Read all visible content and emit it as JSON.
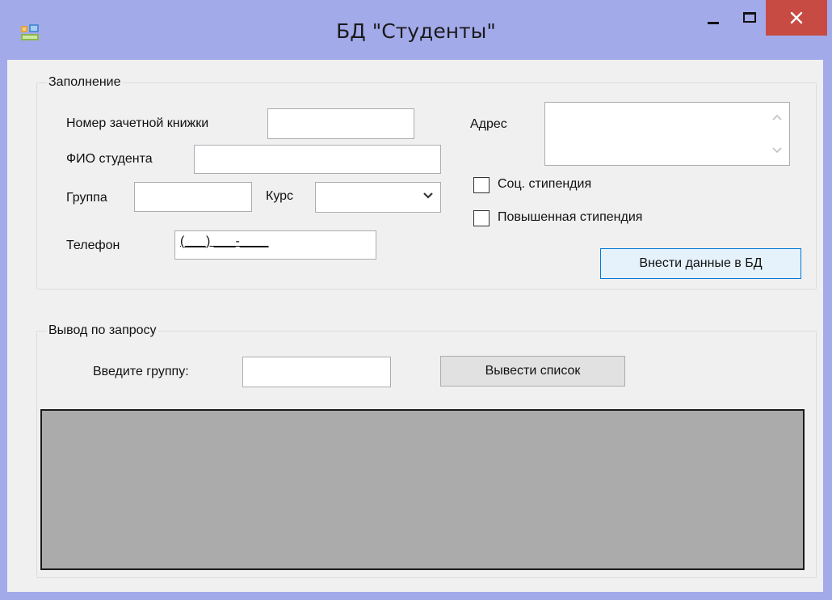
{
  "window": {
    "title": "БД \"Студенты\"",
    "icon": "app-form-icon",
    "colors": {
      "titlebar": "#a3aaea",
      "close_button": "#c74b43",
      "client_bg": "#f0f0f0",
      "grid_bg": "#ababab"
    }
  },
  "fill_group": {
    "legend": "Заполнение",
    "record_book_label": "Номер зачетной книжки",
    "record_book_value": "",
    "student_name_label": "ФИО студента",
    "student_name_value": "",
    "group_label": "Группа",
    "group_value": "",
    "course_label": "Курс",
    "course_value": "",
    "phone_label": "Телефон",
    "phone_mask": "(___) ___-____",
    "address_label": "Адрес",
    "address_value": "",
    "social_scholarship_label": "Соц. стипендия",
    "social_scholarship_checked": false,
    "increased_scholarship_label": "Повышенная стипендия",
    "increased_scholarship_checked": false,
    "submit_label": "Внести данные в БД"
  },
  "query_group": {
    "legend": "Вывод по запросу",
    "enter_group_label": "Введите группу:",
    "enter_group_value": "",
    "show_list_label": "Вывести список"
  }
}
